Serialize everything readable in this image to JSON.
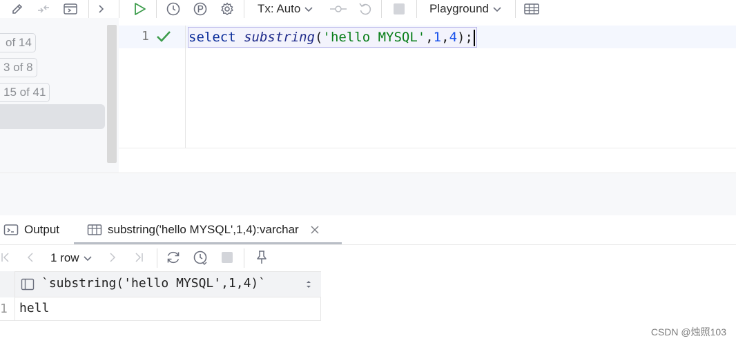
{
  "toolbar": {
    "tx_label": "Tx: Auto",
    "session_label": "Playground",
    "icons": [
      "edit-icon",
      "compare-icon",
      "console-icon",
      "chevron-right-icon",
      "run-icon",
      "history-icon",
      "explain-plan-icon",
      "settings-icon",
      "commit-icon",
      "rollback-icon",
      "stop-icon",
      "table-view-icon"
    ]
  },
  "left_panel": {
    "counters": [
      "of 14",
      "3 of 8",
      "15 of 41"
    ]
  },
  "editor": {
    "line_number": "1",
    "code": {
      "keyword": "select",
      "function": "substring",
      "open_paren": "(",
      "string": "'hello MYSQL'",
      "comma1": ",",
      "arg1": "1",
      "comma2": ",",
      "arg2": "4",
      "close_paren": ")",
      "semicolon": ";"
    }
  },
  "results": {
    "tabs": [
      {
        "label": "Output"
      },
      {
        "label": "substring('hello MYSQL',1,4):varchar"
      }
    ],
    "row_count": "1 row",
    "columns": [
      "`substring('hello MYSQL',1,4)`"
    ],
    "rows": [
      {
        "row_number": "1",
        "value": "hell"
      }
    ]
  },
  "watermark": "CSDN @烛照103",
  "colors": {
    "accent_green": "#3c9c4b",
    "keyword": "#0b2d9a",
    "string": "#067d17",
    "number": "#1750eb"
  }
}
